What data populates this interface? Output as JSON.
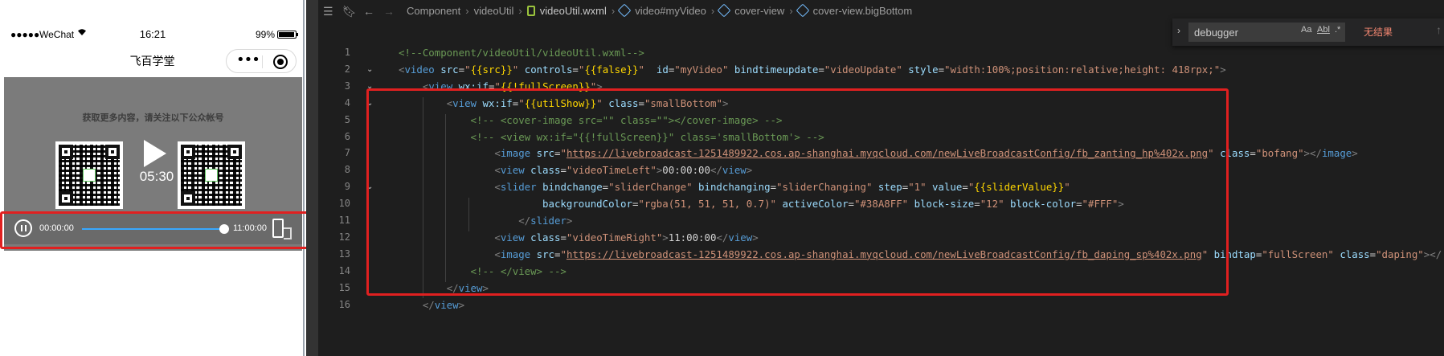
{
  "phone": {
    "status": {
      "signal": "●●●●●",
      "carrier": "WeChat",
      "time": "16:21",
      "battery": "99%"
    },
    "nav": {
      "title": "飞百学堂",
      "more": "•••"
    },
    "video": {
      "promo_text": "获取更多内容，请关注以下公众帐号",
      "duration": "05:30",
      "time_left": "00:00:00",
      "time_right": "11:00:00",
      "progress": 0.96
    }
  },
  "editor": {
    "breadcrumbs": [
      "Component",
      "videoUtil",
      "videoUtil.wxml",
      "video#myVideo",
      "cover-view",
      "cover-view.bigBottom"
    ],
    "find": {
      "query": "debugger",
      "match_case": "Aa",
      "whole_word": "Abl",
      "regex": ".*",
      "result": "无结果"
    },
    "line_numbers": [
      "1",
      "2",
      "3",
      "4",
      "5",
      "6",
      "7",
      "8",
      "9",
      "10",
      "11",
      "12",
      "13",
      "14",
      "15",
      "16"
    ],
    "colors": {
      "tag": "#569cd6",
      "attr": "#9cdcfe",
      "string": "#ce9178",
      "expression": "#ffd700",
      "comment": "#6a9955",
      "highlight": "#e02020"
    },
    "lines": [
      [
        [
          "t-com",
          "<!--Component/videoUtil/videoUtil.wxml-->"
        ]
      ],
      [
        [
          "t-pun",
          "<"
        ],
        [
          "t-tag",
          "video"
        ],
        [
          "t-pl",
          " "
        ],
        [
          "t-attr",
          "src"
        ],
        [
          "t-pl",
          "="
        ],
        [
          "t-str",
          "\""
        ],
        [
          "t-exp",
          "{{src}}"
        ],
        [
          "t-str",
          "\""
        ],
        [
          "t-pl",
          " "
        ],
        [
          "t-attr",
          "controls"
        ],
        [
          "t-pl",
          "="
        ],
        [
          "t-str",
          "\""
        ],
        [
          "t-exp",
          "{{false}}"
        ],
        [
          "t-str",
          "\""
        ],
        [
          "t-pl",
          "  "
        ],
        [
          "t-attr",
          "id"
        ],
        [
          "t-pl",
          "="
        ],
        [
          "t-str",
          "\"myVideo\""
        ],
        [
          "t-pl",
          " "
        ],
        [
          "t-attr",
          "bindtimeupdate"
        ],
        [
          "t-pl",
          "="
        ],
        [
          "t-str",
          "\"videoUpdate\""
        ],
        [
          "t-pl",
          " "
        ],
        [
          "t-attr",
          "style"
        ],
        [
          "t-pl",
          "="
        ],
        [
          "t-str",
          "\"width:100%;position:relative;height: 418rpx;\""
        ],
        [
          "t-pun",
          ">"
        ]
      ],
      [
        [
          "t-pl",
          "    "
        ],
        [
          "t-pun",
          "<"
        ],
        [
          "t-tag",
          "view"
        ],
        [
          "t-pl",
          " "
        ],
        [
          "t-attr",
          "wx:if"
        ],
        [
          "t-pl",
          "="
        ],
        [
          "t-str",
          "\""
        ],
        [
          "t-exp",
          "{{!fullScreen}}"
        ],
        [
          "t-str",
          "\""
        ],
        [
          "t-pun",
          ">"
        ]
      ],
      [
        [
          "t-pl",
          "        "
        ],
        [
          "t-pun",
          "<"
        ],
        [
          "t-tag",
          "view"
        ],
        [
          "t-pl",
          " "
        ],
        [
          "t-attr",
          "wx:if"
        ],
        [
          "t-pl",
          "="
        ],
        [
          "t-str",
          "\""
        ],
        [
          "t-exp",
          "{{utilShow}}"
        ],
        [
          "t-str",
          "\""
        ],
        [
          "t-pl",
          " "
        ],
        [
          "t-attr",
          "class"
        ],
        [
          "t-pl",
          "="
        ],
        [
          "t-str",
          "\"smallBottom\""
        ],
        [
          "t-pun",
          ">"
        ]
      ],
      [
        [
          "t-pl",
          "            "
        ],
        [
          "t-com",
          "<!-- <cover-image src=\"\" class=\"\"></cover-image> -->"
        ]
      ],
      [
        [
          "t-pl",
          "            "
        ],
        [
          "t-com",
          "<!-- <view wx:if=\"{{!fullScreen}}\" class='smallBottom'> -->"
        ]
      ],
      [
        [
          "t-pl",
          "                "
        ],
        [
          "t-pun",
          "<"
        ],
        [
          "t-tag",
          "image"
        ],
        [
          "t-pl",
          " "
        ],
        [
          "t-attr",
          "src"
        ],
        [
          "t-pl",
          "="
        ],
        [
          "t-str",
          "\""
        ],
        [
          "t-url",
          "https://livebroadcast-1251489922.cos.ap-shanghai.myqcloud.com/newLiveBroadcastConfig/fb_zanting_hp%402x.png"
        ],
        [
          "t-str",
          "\""
        ],
        [
          "t-pl",
          " "
        ],
        [
          "t-attr",
          "class"
        ],
        [
          "t-pl",
          "="
        ],
        [
          "t-str",
          "\"bofang\""
        ],
        [
          "t-pun",
          "></"
        ],
        [
          "t-tag",
          "image"
        ],
        [
          "t-pun",
          ">"
        ]
      ],
      [
        [
          "t-pl",
          "                "
        ],
        [
          "t-pun",
          "<"
        ],
        [
          "t-tag",
          "view"
        ],
        [
          "t-pl",
          " "
        ],
        [
          "t-attr",
          "class"
        ],
        [
          "t-pl",
          "="
        ],
        [
          "t-str",
          "\"videoTimeLeft\""
        ],
        [
          "t-pun",
          ">"
        ],
        [
          "t-pl",
          "00:00:00"
        ],
        [
          "t-pun",
          "</"
        ],
        [
          "t-tag",
          "view"
        ],
        [
          "t-pun",
          ">"
        ]
      ],
      [
        [
          "t-pl",
          "                "
        ],
        [
          "t-pun",
          "<"
        ],
        [
          "t-tag",
          "slider"
        ],
        [
          "t-pl",
          " "
        ],
        [
          "t-attr",
          "bindchange"
        ],
        [
          "t-pl",
          "="
        ],
        [
          "t-str",
          "\"sliderChange\""
        ],
        [
          "t-pl",
          " "
        ],
        [
          "t-attr",
          "bindchanging"
        ],
        [
          "t-pl",
          "="
        ],
        [
          "t-str",
          "\"sliderChanging\""
        ],
        [
          "t-pl",
          " "
        ],
        [
          "t-attr",
          "step"
        ],
        [
          "t-pl",
          "="
        ],
        [
          "t-str",
          "\"1\""
        ],
        [
          "t-pl",
          " "
        ],
        [
          "t-attr",
          "value"
        ],
        [
          "t-pl",
          "="
        ],
        [
          "t-str",
          "\""
        ],
        [
          "t-exp",
          "{{sliderValue}}"
        ],
        [
          "t-str",
          "\""
        ]
      ],
      [
        [
          "t-pl",
          "                        "
        ],
        [
          "t-attr",
          "backgroundColor"
        ],
        [
          "t-pl",
          "="
        ],
        [
          "t-str",
          "\"rgba(51, 51, 51, 0.7)\""
        ],
        [
          "t-pl",
          " "
        ],
        [
          "t-attr",
          "activeColor"
        ],
        [
          "t-pl",
          "="
        ],
        [
          "t-str",
          "\"#38A8FF\""
        ],
        [
          "t-pl",
          " "
        ],
        [
          "t-attr",
          "block-size"
        ],
        [
          "t-pl",
          "="
        ],
        [
          "t-str",
          "\"12\""
        ],
        [
          "t-pl",
          " "
        ],
        [
          "t-attr",
          "block-color"
        ],
        [
          "t-pl",
          "="
        ],
        [
          "t-str",
          "\"#FFF\""
        ],
        [
          "t-pun",
          ">"
        ]
      ],
      [
        [
          "t-pl",
          "                    "
        ],
        [
          "t-pun",
          "</"
        ],
        [
          "t-tag",
          "slider"
        ],
        [
          "t-pun",
          ">"
        ]
      ],
      [
        [
          "t-pl",
          "                "
        ],
        [
          "t-pun",
          "<"
        ],
        [
          "t-tag",
          "view"
        ],
        [
          "t-pl",
          " "
        ],
        [
          "t-attr",
          "class"
        ],
        [
          "t-pl",
          "="
        ],
        [
          "t-str",
          "\"videoTimeRight\""
        ],
        [
          "t-pun",
          ">"
        ],
        [
          "t-pl",
          "11:00:00"
        ],
        [
          "t-pun",
          "</"
        ],
        [
          "t-tag",
          "view"
        ],
        [
          "t-pun",
          ">"
        ]
      ],
      [
        [
          "t-pl",
          "                "
        ],
        [
          "t-pun",
          "<"
        ],
        [
          "t-tag",
          "image"
        ],
        [
          "t-pl",
          " "
        ],
        [
          "t-attr",
          "src"
        ],
        [
          "t-pl",
          "="
        ],
        [
          "t-str",
          "\""
        ],
        [
          "t-url",
          "https://livebroadcast-1251489922.cos.ap-shanghai.myqcloud.com/newLiveBroadcastConfig/fb_daping_sp%402x.png"
        ],
        [
          "t-str",
          "\""
        ],
        [
          "t-pl",
          " "
        ],
        [
          "t-attr",
          "bindtap"
        ],
        [
          "t-pl",
          "="
        ],
        [
          "t-str",
          "\"fullScreen\""
        ],
        [
          "t-pl",
          " "
        ],
        [
          "t-attr",
          "class"
        ],
        [
          "t-pl",
          "="
        ],
        [
          "t-str",
          "\"daping\""
        ],
        [
          "t-pun",
          "></"
        ]
      ],
      [
        [
          "t-pl",
          "            "
        ],
        [
          "t-com",
          "<!-- </view> -->"
        ]
      ],
      [
        [
          "t-pl",
          "        "
        ],
        [
          "t-pun",
          "</"
        ],
        [
          "t-tag",
          "view"
        ],
        [
          "t-pun",
          ">"
        ]
      ],
      [
        [
          "t-pl",
          "    "
        ],
        [
          "t-pun",
          "</"
        ],
        [
          "t-tag",
          "view"
        ],
        [
          "t-pun",
          ">"
        ]
      ]
    ]
  }
}
